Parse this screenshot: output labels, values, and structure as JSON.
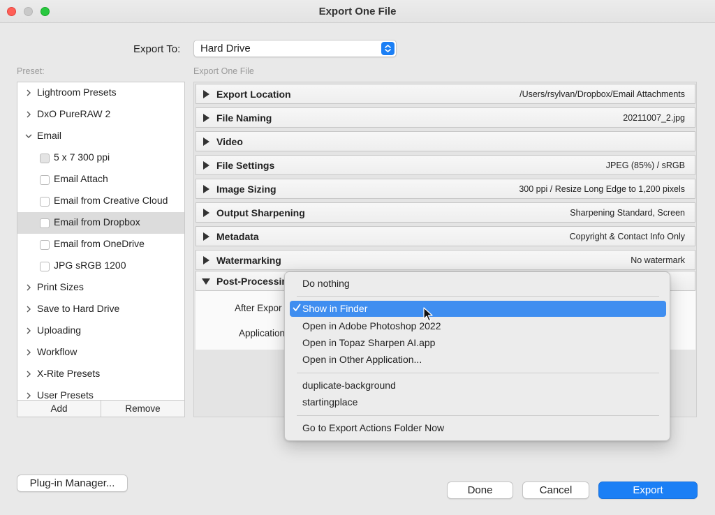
{
  "window": {
    "title": "Export One File"
  },
  "export_to": {
    "label": "Export To:",
    "value": "Hard Drive"
  },
  "preset_label": "Preset:",
  "panel_label": "Export One File",
  "presets": [
    {
      "label": "Lightroom Presets",
      "type": "folder",
      "expanded": false
    },
    {
      "label": "DxO PureRAW 2",
      "type": "folder",
      "expanded": false
    },
    {
      "label": "Email",
      "type": "folder",
      "expanded": true
    },
    {
      "label": "5 x 7 300 ppi",
      "type": "preset"
    },
    {
      "label": "Email Attach",
      "type": "preset"
    },
    {
      "label": "Email from Creative Cloud",
      "type": "preset"
    },
    {
      "label": "Email from Dropbox",
      "type": "preset",
      "selected": true
    },
    {
      "label": "Email from OneDrive",
      "type": "preset"
    },
    {
      "label": "JPG sRGB 1200",
      "type": "preset"
    },
    {
      "label": "Print Sizes",
      "type": "folder",
      "expanded": false
    },
    {
      "label": "Save to Hard Drive",
      "type": "folder",
      "expanded": false
    },
    {
      "label": "Uploading",
      "type": "folder",
      "expanded": false
    },
    {
      "label": "Workflow",
      "type": "folder",
      "expanded": false
    },
    {
      "label": "X-Rite Presets",
      "type": "folder",
      "expanded": false
    },
    {
      "label": "User Presets",
      "type": "folder",
      "expanded": false
    }
  ],
  "preset_buttons": {
    "add": "Add",
    "remove": "Remove"
  },
  "sections": [
    {
      "title": "Export Location",
      "value": "/Users/rsylvan/Dropbox/Email Attachments"
    },
    {
      "title": "File Naming",
      "value": "20211007_2.jpg"
    },
    {
      "title": "Video",
      "value": ""
    },
    {
      "title": "File Settings",
      "value": "JPEG (85%) / sRGB"
    },
    {
      "title": "Image Sizing",
      "value": "300 ppi / Resize Long Edge to 1,200 pixels"
    },
    {
      "title": "Output Sharpening",
      "value": "Sharpening Standard, Screen"
    },
    {
      "title": "Metadata",
      "value": "Copyright & Contact Info Only"
    },
    {
      "title": "Watermarking",
      "value": "No watermark"
    },
    {
      "title": "Post-Processing",
      "value": "",
      "expanded": true
    }
  ],
  "post_processing": {
    "after_export_label": "After Expor",
    "application_label": "Application"
  },
  "after_export_menu": {
    "items": [
      "Do nothing",
      "Show in Finder",
      "Open in Adobe Photoshop 2022",
      "Open in Topaz Sharpen AI.app",
      "Open in Other Application...",
      "duplicate-background",
      "startingplace",
      "Go to Export Actions Folder Now"
    ],
    "selected": "Show in Finder"
  },
  "buttons": {
    "plugin_manager": "Plug-in Manager...",
    "done": "Done",
    "cancel": "Cancel",
    "export": "Export"
  },
  "colors": {
    "accent": "#1b7ff5",
    "highlight": "#3f8ef0"
  }
}
